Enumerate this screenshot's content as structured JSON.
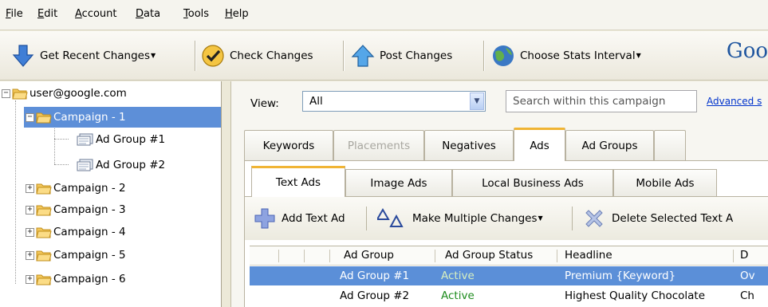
{
  "menu": {
    "items": [
      {
        "label": "File",
        "accel": "F",
        "rest": "ile"
      },
      {
        "label": "Edit",
        "accel": "E",
        "rest": "dit"
      },
      {
        "label": "Account",
        "accel": "A",
        "rest": "ccount"
      },
      {
        "label": "Data",
        "accel": "D",
        "rest": "ata"
      },
      {
        "label": "Tools",
        "accel": "T",
        "rest": "ools"
      },
      {
        "label": "Help",
        "accel": "H",
        "rest": "elp"
      }
    ]
  },
  "toolbar": {
    "get_recent": "Get Recent Changes",
    "check": "Check Changes",
    "post": "Post Changes",
    "stats": "Choose Stats Interval",
    "brand_partial": "Goo"
  },
  "tree": {
    "account": "user@google.com",
    "campaign1": "Campaign - 1",
    "adgroup1": "Ad Group #1",
    "adgroup2": "Ad Group #2",
    "campaign2": "Campaign - 2",
    "campaign3": "Campaign - 3",
    "campaign4": "Campaign - 4",
    "campaign5": "Campaign - 5",
    "campaign6": "Campaign - 6"
  },
  "filter": {
    "view_label": "View:",
    "view_value": "All",
    "search_placeholder": "Search within this campaign",
    "advanced_link": "Advanced s"
  },
  "tabs1": {
    "keywords": "Keywords",
    "placements": "Placements",
    "negatives": "Negatives",
    "ads": "Ads",
    "ad_groups": "Ad Groups"
  },
  "tabs2": {
    "text_ads": "Text Ads",
    "image_ads": "Image Ads",
    "local_business_ads": "Local Business Ads",
    "mobile_ads": "Mobile Ads"
  },
  "subtoolbar": {
    "add_text_ad": "Add Text Ad",
    "make_multiple": "Make Multiple Changes",
    "delete_selected": "Delete Selected Text A"
  },
  "grid": {
    "headers": {
      "ad_group": "Ad Group",
      "status": "Ad Group Status",
      "headline": "Headline",
      "d": "D"
    },
    "rows": [
      {
        "ad_group": "Ad Group #1",
        "status": "Active",
        "headline": "Premium {Keyword}",
        "d": "Ov"
      },
      {
        "ad_group": "Ad Group #2",
        "status": "Active",
        "headline": "Highest Quality Chocolate",
        "d": "Ch"
      }
    ]
  },
  "colors": {
    "selection": "#5b8fd8",
    "tab_accent": "#f0b434",
    "status_active": "#1d8b1d",
    "link": "#0033cc"
  }
}
